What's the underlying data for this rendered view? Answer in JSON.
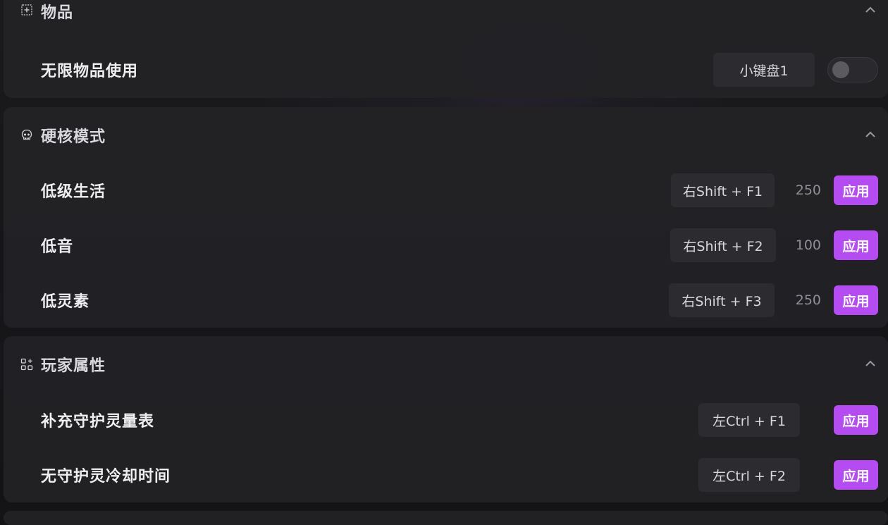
{
  "sections": [
    {
      "title": "物品",
      "icon": "plus-square-icon",
      "rows": [
        {
          "label": "无限物品使用",
          "hotkey": "小键盘1",
          "toggle_on": false
        }
      ]
    },
    {
      "title": "硬核模式",
      "icon": "skull-icon",
      "rows": [
        {
          "label": "低级生活",
          "hotkey": "右Shift + F1",
          "value": "250",
          "apply": "应用"
        },
        {
          "label": "低音",
          "hotkey": "右Shift + F2",
          "value": "100",
          "apply": "应用"
        },
        {
          "label": "低灵素",
          "hotkey": "右Shift + F3",
          "value": "250",
          "apply": "应用"
        }
      ]
    },
    {
      "title": "玩家属性",
      "icon": "grid-plus-icon",
      "rows": [
        {
          "label": "补充守护灵量表",
          "hotkey": "左Ctrl + F1",
          "apply": "应用"
        },
        {
          "label": "无守护灵冷却时间",
          "hotkey": "左Ctrl + F2",
          "apply": "应用"
        }
      ]
    }
  ],
  "colors": {
    "accent": "#b54cf2",
    "panel": "#222225",
    "hotkey_bg": "#2c2c30"
  }
}
